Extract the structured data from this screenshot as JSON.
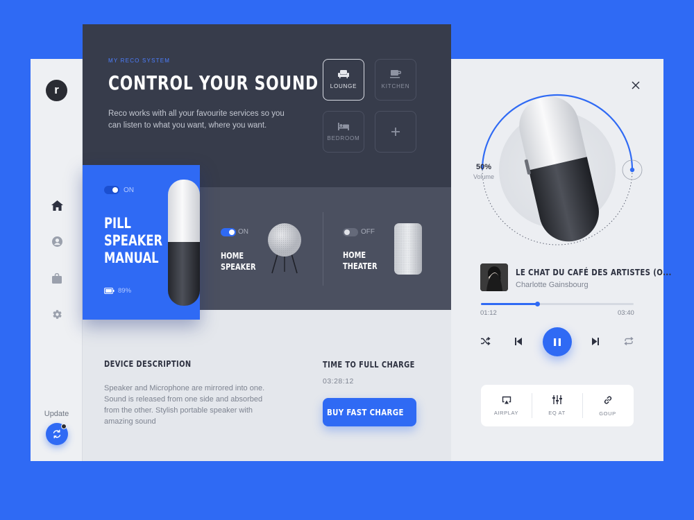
{
  "brand": {
    "logo_letter": "r"
  },
  "sidebar": {
    "nav": [
      {
        "id": "home",
        "icon": "home-icon",
        "active": true
      },
      {
        "id": "profile",
        "icon": "user-icon"
      },
      {
        "id": "store",
        "icon": "bag-icon"
      },
      {
        "id": "settings",
        "icon": "gear-icon"
      }
    ],
    "update_label": "Update"
  },
  "hero": {
    "eyebrow": "MY RECO SYSTEM",
    "title": "CONTROL YOUR SOUND",
    "description": "Reco works with all your favourite services so you can listen to what you want, where you want.",
    "rooms": [
      {
        "label": "LOUNGE",
        "icon": "sofa-icon",
        "active": true
      },
      {
        "label": "KITCHEN",
        "icon": "coffee-cup-icon",
        "active": false
      },
      {
        "label": "BEDROOM",
        "icon": "bed-icon",
        "active": false
      },
      {
        "label": "",
        "icon": "plus-icon",
        "active": false
      }
    ]
  },
  "devices": {
    "pill": {
      "toggle": "ON",
      "name_lines": [
        "PILL",
        "SPEAKER",
        "MANUAL"
      ],
      "battery": "89%"
    },
    "home_speaker": {
      "toggle": "ON",
      "name_lines": [
        "HOME",
        "SPEAKER"
      ]
    },
    "home_theater": {
      "toggle": "OFF",
      "name_lines": [
        "HOME",
        "THEATER"
      ]
    }
  },
  "details": {
    "description_title": "DEVICE DESCRIPTION",
    "description": "Speaker and Microphone are mirrored into one. Sound is released from one side and absorbed from the other. Stylish portable speaker with amazing sound",
    "charge_title": "TIME TO FULL CHARGE",
    "charge_time": "03:28:12",
    "charge_button": "BUY FAST CHARGE"
  },
  "player": {
    "volume": {
      "percent": "50%",
      "label": "Volume",
      "value": 0.5
    },
    "song_title": "LE CHAT DU CAFÉ DES ARTISTES (O...",
    "artist": "Charlotte Gainsbourg",
    "elapsed": "01:12",
    "total": "03:40",
    "progress": 0.37,
    "outputs": [
      {
        "label": "AIRPLAY",
        "icon": "airplay-icon"
      },
      {
        "label": "EQ AT",
        "icon": "equalizer-icon"
      },
      {
        "label": "GOUP",
        "icon": "link-icon"
      }
    ]
  },
  "colors": {
    "accent": "#2f6af4",
    "dark": "#373c4b",
    "mid_dark": "#4b5060",
    "panel": "#e4e7ec"
  }
}
